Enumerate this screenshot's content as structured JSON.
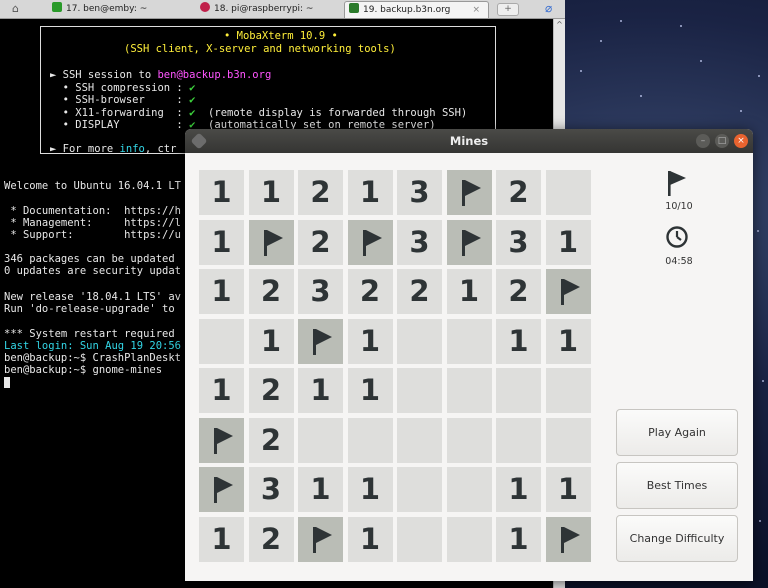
{
  "tabs": [
    {
      "label": "17. ben@emby: ~",
      "color": "#2a9a2a"
    },
    {
      "label": "18. pi@raspberrypi: ~",
      "color": "#c0204a"
    },
    {
      "label": "19. backup.b3n.org",
      "color": "#2a7a2a",
      "close": "×"
    }
  ],
  "terminal": {
    "banner_title": "• MobaXterm 10.9 •",
    "banner_sub": "(SSH client, X-server and networking tools)",
    "ssh_prefix": "► SSH session to ",
    "ssh_user": "ben",
    "ssh_host": "@backup.b3n.org",
    "rows": [
      {
        "label": "  • SSH compression : ",
        "check": "✔",
        "note": ""
      },
      {
        "label": "  • SSH-browser     : ",
        "check": "✔",
        "note": ""
      },
      {
        "label": "  • X11-forwarding  : ",
        "check": "✔",
        "note": "  (remote display is forwarded through SSH)"
      },
      {
        "label": "  • DISPLAY         : ",
        "check": "✔",
        "note": "  (automatically set on remote server)"
      }
    ],
    "more_prefix": "► For more ",
    "more_info": "info",
    "more_suffix": ", ctr",
    "lines": [
      "Welcome to Ubuntu 16.04.1 LT",
      "",
      " * Documentation:  https://h",
      " * Management:     https://l",
      " * Support:        https://u",
      "",
      "346 packages can be updated",
      "0 updates are security updat",
      "",
      "New release '18.04.1 LTS' av",
      "Run 'do-release-upgrade' to",
      "",
      "*** System restart required"
    ],
    "last_login": "Last login: Sun Aug 19 20:56",
    "prompt1": "ben@backup:~$ CrashPlanDeskt",
    "prompt2": "ben@backup:~$ gnome-mines"
  },
  "window": {
    "title": "Mines",
    "flags_icon": "flag-icon",
    "flags_count": "10/10",
    "timer_icon": "clock-icon",
    "timer": "04:58",
    "buttons": {
      "play_again": "Play Again",
      "best_times": "Best Times",
      "change_difficulty": "Change Difficulty"
    }
  },
  "board": [
    [
      "1",
      "1",
      "2",
      "1",
      "3",
      "F",
      "2",
      " "
    ],
    [
      "1",
      "F",
      "2",
      "F",
      "3",
      "F",
      "3",
      "1"
    ],
    [
      "1",
      "2",
      "3",
      "2",
      "2",
      "1",
      "2",
      "F"
    ],
    [
      " ",
      "1",
      "F",
      "1",
      " ",
      " ",
      "1",
      "1"
    ],
    [
      "1",
      "2",
      "1",
      "1",
      " ",
      " ",
      " ",
      " "
    ],
    [
      "F",
      "2",
      " ",
      " ",
      " ",
      " ",
      " ",
      " "
    ],
    [
      "F",
      "3",
      "1",
      "1",
      " ",
      " ",
      "1",
      "1"
    ],
    [
      "1",
      "2",
      "F",
      "1",
      " ",
      " ",
      "1",
      "F"
    ]
  ],
  "colors": {
    "cell": "#dededc",
    "flagged_cell": "#babdb6",
    "close_button": "#e9632f"
  }
}
